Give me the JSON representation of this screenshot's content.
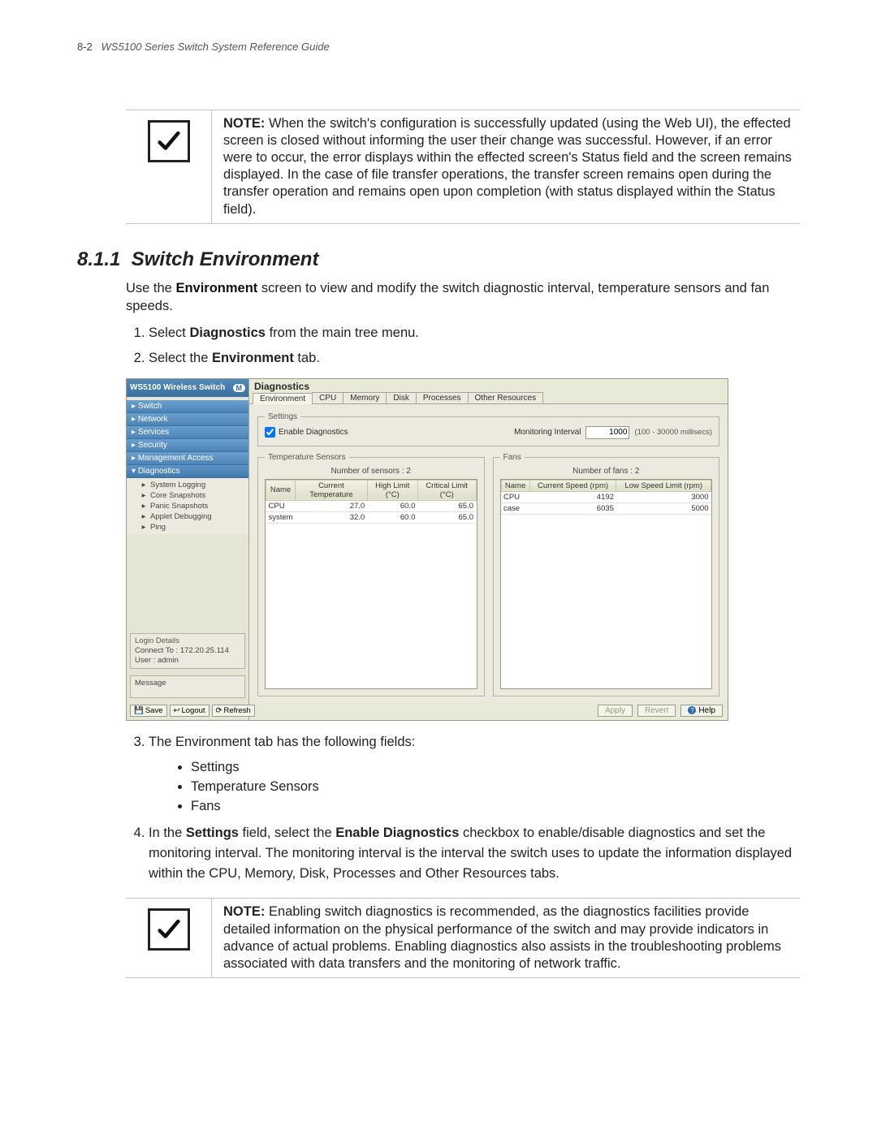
{
  "running_head": {
    "page_num": "8-2",
    "title": "WS5100 Series Switch System Reference Guide"
  },
  "note1": {
    "label": "NOTE:",
    "body": "When the switch's configuration is successfully updated (using the Web UI), the effected screen is closed without informing the user their change was successful. However, if an error were to occur, the error displays within the effected screen's Status field and the screen remains displayed. In the case of file transfer operations, the transfer screen remains open during the transfer operation and remains open upon completion (with status displayed within the Status field)."
  },
  "section": {
    "number": "8.1.1",
    "title": "Switch Environment",
    "intro_pre": "Use the ",
    "intro_b": "Environment",
    "intro_post": " screen to view and modify the switch diagnostic interval, temperature sensors and fan speeds.",
    "step1_pre": "Select ",
    "step1_b": "Diagnostics",
    "step1_post": " from the main tree menu.",
    "step2_pre": "Select the ",
    "step2_b": "Environment",
    "step2_post": " tab."
  },
  "app": {
    "brand": "WS5100 Wireless Switch",
    "nav": {
      "switch": "Switch",
      "network": "Network",
      "services": "Services",
      "security": "Security",
      "mgmt": "Management Access",
      "diag": "Diagnostics",
      "leaf_syslog": "System Logging",
      "leaf_core": "Core Snapshots",
      "leaf_panic": "Panic Snapshots",
      "leaf_applet": "Applet Debugging",
      "leaf_ping": "Ping"
    },
    "login": {
      "legend": "Login Details",
      "connect_label": "Connect To :",
      "connect_value": "172.20.25.114",
      "user_label": "User :",
      "user_value": "admin"
    },
    "message_label": "Message",
    "side_buttons": {
      "save": "Save",
      "logout": "Logout",
      "refresh": "Refresh"
    },
    "main_title": "Diagnostics",
    "tabs": {
      "env": "Environment",
      "cpu": "CPU",
      "mem": "Memory",
      "disk": "Disk",
      "proc": "Processes",
      "other": "Other Resources"
    },
    "settings": {
      "legend": "Settings",
      "enable_label": "Enable Diagnostics",
      "mon_label": "Monitoring Interval",
      "mon_value": "1000",
      "mon_hint": "(100 - 30000 millisecs)"
    },
    "temp": {
      "legend": "Temperature Sensors",
      "count_label": "Number of sensors :",
      "count_value": "2",
      "h_name": "Name",
      "h_curr": "Current Temperature",
      "h_high": "High Limit (°C)",
      "h_crit": "Critical Limit (°C)",
      "rows": [
        {
          "name": "CPU",
          "curr": "27.0",
          "high": "60.0",
          "crit": "65.0"
        },
        {
          "name": "system",
          "curr": "32.0",
          "high": "60.0",
          "crit": "65.0"
        }
      ]
    },
    "fans": {
      "legend": "Fans",
      "count_label": "Number of fans :",
      "count_value": "2",
      "h_name": "Name",
      "h_speed": "Current Speed (rpm)",
      "h_low": "Low Speed Limit (rpm)",
      "rows": [
        {
          "name": "CPU",
          "speed": "4192",
          "low": "3000"
        },
        {
          "name": "case",
          "speed": "6035",
          "low": "5000"
        }
      ]
    },
    "buttons": {
      "apply": "Apply",
      "revert": "Revert",
      "help": "Help"
    }
  },
  "post": {
    "step3": "The Environment tab has the following fields:",
    "b_settings": "Settings",
    "b_temp": "Temperature Sensors",
    "b_fans": "Fans",
    "step4_pre": "In the ",
    "step4_b1": "Settings",
    "step4_mid": " field, select the ",
    "step4_b2": "Enable Diagnostics",
    "step4_post": " checkbox to enable/disable diagnostics and set the monitoring interval. The monitoring interval is the interval the switch uses to update the information displayed within the CPU, Memory, Disk, Processes and Other Resources tabs."
  },
  "note2": {
    "label": "NOTE:",
    "body": "Enabling switch diagnostics is recommended, as the diagnostics facilities provide detailed information on the physical performance of the switch and may provide indicators in advance of actual problems. Enabling diagnostics also assists in the troubleshooting problems associated with data transfers and the monitoring of network traffic."
  }
}
